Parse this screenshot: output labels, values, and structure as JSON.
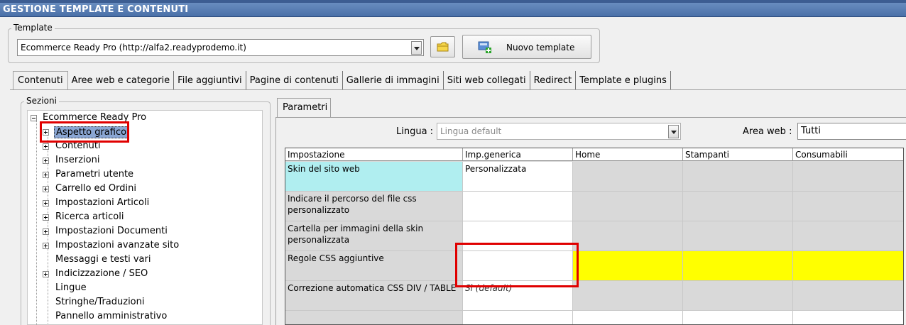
{
  "window": {
    "title": "GESTIONE TEMPLATE E CONTENUTI"
  },
  "template_group": {
    "label": "Template",
    "selected": "Ecommerce Ready Pro (http://alfa2.readyprodemo.it)",
    "new_button_label": "Nuovo template",
    "folder_icon": "folder-icon",
    "new_icon": "new-template-icon"
  },
  "tabs": [
    {
      "label": "Contenuti",
      "active": true
    },
    {
      "label": "Aree web e categorie"
    },
    {
      "label": "File aggiuntivi"
    },
    {
      "label": "Pagine di contenuti"
    },
    {
      "label": "Gallerie di immagini"
    },
    {
      "label": "Siti web collegati"
    },
    {
      "label": "Redirect"
    },
    {
      "label": "Template e plugins"
    }
  ],
  "sections": {
    "label": "Sezioni",
    "root": "Ecommerce Ready Pro",
    "items": [
      {
        "label": "Aspetto grafico",
        "expandable": true,
        "selected": true
      },
      {
        "label": "Contenuti",
        "expandable": true
      },
      {
        "label": "Inserzioni",
        "expandable": true
      },
      {
        "label": "Parametri utente",
        "expandable": true
      },
      {
        "label": "Carrello ed Ordini",
        "expandable": true
      },
      {
        "label": "Impostazioni Articoli",
        "expandable": true
      },
      {
        "label": "Ricerca articoli",
        "expandable": true
      },
      {
        "label": "Impostazioni Documenti",
        "expandable": true
      },
      {
        "label": "Impostazioni avanzate sito",
        "expandable": true
      },
      {
        "label": "Messaggi e testi vari",
        "expandable": false
      },
      {
        "label": "Indicizzazione / SEO",
        "expandable": true
      },
      {
        "label": "Lingue",
        "expandable": false
      },
      {
        "label": "Stringhe/Traduzioni",
        "expandable": false
      },
      {
        "label": "Pannello amministrativo",
        "expandable": false
      }
    ]
  },
  "params": {
    "tab_label": "Parametri",
    "lingua_label": "Lingua :",
    "lingua_value": "Lingua default",
    "area_label": "Area web :",
    "area_value": "Tutti",
    "columns": [
      "Impostazione",
      "Imp.generica",
      "Home",
      "Stampanti",
      "Consumabili"
    ],
    "rows": [
      {
        "setting": "Skin del sito web",
        "generic": "Personalizzata"
      },
      {
        "setting": "Indicare il percorso del file css personalizzato",
        "generic": ""
      },
      {
        "setting": "Cartella per immagini della skin personalizzata",
        "generic": ""
      },
      {
        "setting": "Regole CSS aggiuntive",
        "generic": ""
      },
      {
        "setting": "Correzione automatica CSS DIV / TABLE",
        "generic": "Sì (default)"
      }
    ],
    "colors": {
      "selected_setting": "#b0eef0",
      "highlight_row": "#ffff00",
      "annotation": "#e00000"
    }
  }
}
